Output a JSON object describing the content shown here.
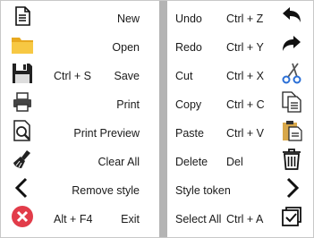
{
  "left_items": [
    {
      "name": "new",
      "label": "New",
      "shortcut": "",
      "icon": "new-document-icon"
    },
    {
      "name": "open",
      "label": "Open",
      "shortcut": "",
      "icon": "folder-icon"
    },
    {
      "name": "save",
      "label": "Save",
      "shortcut": "Ctrl + S",
      "icon": "floppy-disk-icon"
    },
    {
      "name": "print",
      "label": "Print",
      "shortcut": "",
      "icon": "printer-icon"
    },
    {
      "name": "print-preview",
      "label": "Print Preview",
      "shortcut": "",
      "icon": "print-preview-icon"
    },
    {
      "name": "clear-all",
      "label": "Clear All",
      "shortcut": "",
      "icon": "broom-icon"
    },
    {
      "name": "remove-style",
      "label": "Remove style",
      "shortcut": "",
      "icon": "chevron-left-icon"
    },
    {
      "name": "exit",
      "label": "Exit",
      "shortcut": "Alt + F4",
      "icon": "close-circle-icon"
    }
  ],
  "right_items": [
    {
      "name": "undo",
      "label": "Undo",
      "shortcut": "Ctrl + Z",
      "icon": "undo-arrow-icon"
    },
    {
      "name": "redo",
      "label": "Redo",
      "shortcut": "Ctrl + Y",
      "icon": "redo-arrow-icon"
    },
    {
      "name": "cut",
      "label": "Cut",
      "shortcut": "Ctrl + X",
      "icon": "scissors-icon"
    },
    {
      "name": "copy",
      "label": "Copy",
      "shortcut": "Ctrl + C",
      "icon": "copy-icon"
    },
    {
      "name": "paste",
      "label": "Paste",
      "shortcut": "Ctrl + V",
      "icon": "clipboard-icon"
    },
    {
      "name": "delete",
      "label": "Delete",
      "shortcut": "Del",
      "icon": "trash-icon"
    },
    {
      "name": "style-token",
      "label": "Style token",
      "shortcut": "",
      "icon": "chevron-right-icon"
    },
    {
      "name": "select-all",
      "label": "Select All",
      "shortcut": "Ctrl + A",
      "icon": "select-all-icon"
    }
  ]
}
